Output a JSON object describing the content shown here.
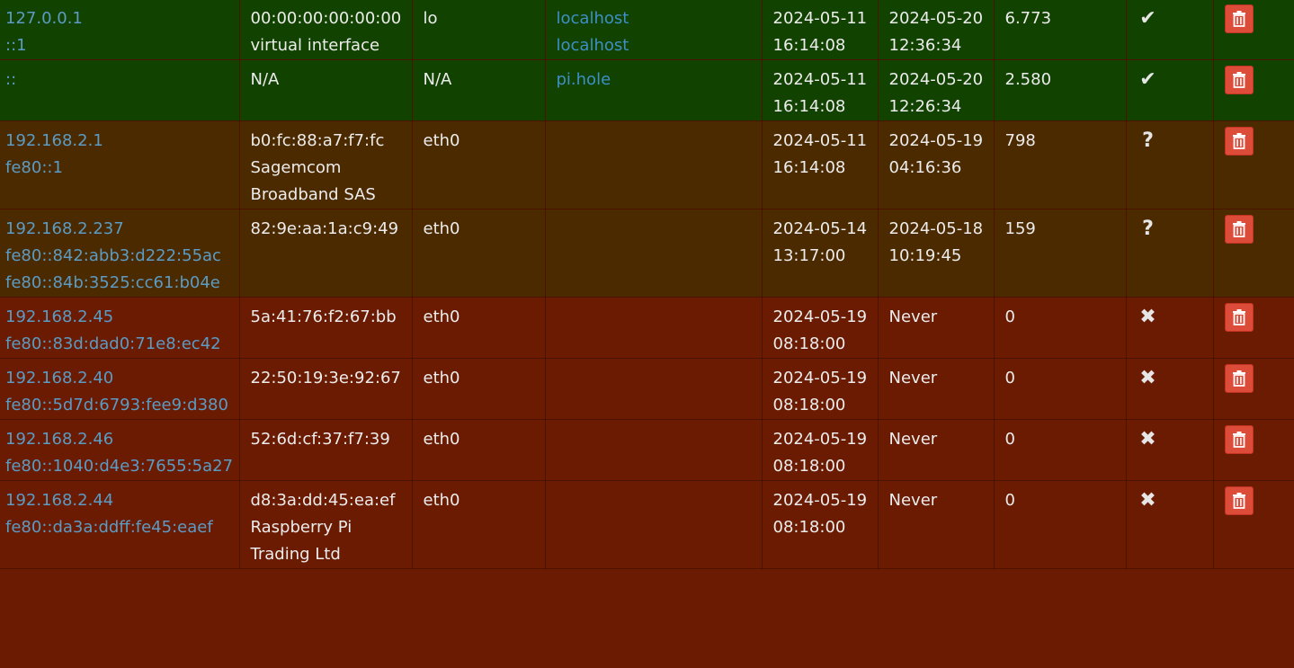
{
  "colors": {
    "active_row": "#124200",
    "unknown_row": "#4c2a00",
    "never_row": "#6a1b02",
    "link": "#3d8fc7",
    "delete_button": "#dd4b39"
  },
  "rows": [
    {
      "status": "active",
      "ips": [
        "127.0.0.1",
        "::1"
      ],
      "hw": [
        "00:00:00:00:00:00",
        "virtual interface"
      ],
      "iface": "lo",
      "names": [
        "localhost",
        "localhost"
      ],
      "first_seen": [
        "2024-05-11",
        "16:14:08"
      ],
      "last_query": [
        "2024-05-20",
        "12:36:34"
      ],
      "queries": "6.773",
      "status_icon": "checkmark-icon"
    },
    {
      "status": "active",
      "ips": [
        "::"
      ],
      "hw": [
        "N/A"
      ],
      "iface": "N/A",
      "names": [
        "pi.hole"
      ],
      "first_seen": [
        "2024-05-11",
        "16:14:08"
      ],
      "last_query": [
        "2024-05-20",
        "12:26:34"
      ],
      "queries": "2.580",
      "status_icon": "checkmark-icon"
    },
    {
      "status": "unknown",
      "ips": [
        "192.168.2.1",
        "fe80::1"
      ],
      "hw": [
        "b0:fc:88:a7:f7:fc",
        "Sagemcom",
        "Broadband SAS"
      ],
      "iface": "eth0",
      "names": [],
      "first_seen": [
        "2024-05-11",
        "16:14:08"
      ],
      "last_query": [
        "2024-05-19",
        "04:16:36"
      ],
      "queries": "798",
      "status_icon": "question-icon"
    },
    {
      "status": "unknown",
      "ips": [
        "192.168.2.237",
        "fe80::842:abb3:d222:55ac",
        "fe80::84b:3525:cc61:b04e"
      ],
      "hw": [
        "82:9e:aa:1a:c9:49"
      ],
      "iface": "eth0",
      "names": [],
      "first_seen": [
        "2024-05-14",
        "13:17:00"
      ],
      "last_query": [
        "2024-05-18",
        "10:19:45"
      ],
      "queries": "159",
      "status_icon": "question-icon"
    },
    {
      "status": "never",
      "ips": [
        "192.168.2.45",
        "fe80::83d:dad0:71e8:ec42"
      ],
      "hw": [
        "5a:41:76:f2:67:bb"
      ],
      "iface": "eth0",
      "names": [],
      "first_seen": [
        "2024-05-19",
        "08:18:00"
      ],
      "last_query": [
        "Never"
      ],
      "queries": "0",
      "status_icon": "cross-icon"
    },
    {
      "status": "never",
      "ips": [
        "192.168.2.40",
        "fe80::5d7d:6793:fee9:d380"
      ],
      "hw": [
        "22:50:19:3e:92:67"
      ],
      "iface": "eth0",
      "names": [],
      "first_seen": [
        "2024-05-19",
        "08:18:00"
      ],
      "last_query": [
        "Never"
      ],
      "queries": "0",
      "status_icon": "cross-icon"
    },
    {
      "status": "never",
      "ips": [
        "192.168.2.46",
        "fe80::1040:d4e3:7655:5a27"
      ],
      "hw": [
        "52:6d:cf:37:f7:39"
      ],
      "iface": "eth0",
      "names": [],
      "first_seen": [
        "2024-05-19",
        "08:18:00"
      ],
      "last_query": [
        "Never"
      ],
      "queries": "0",
      "status_icon": "cross-icon"
    },
    {
      "status": "never",
      "ips": [
        "192.168.2.44",
        "fe80::da3a:ddff:fe45:eaef"
      ],
      "hw": [
        "d8:3a:dd:45:ea:ef",
        "Raspberry Pi",
        "Trading Ltd"
      ],
      "iface": "eth0",
      "names": [],
      "first_seen": [
        "2024-05-19",
        "08:18:00"
      ],
      "last_query": [
        "Never"
      ],
      "queries": "0",
      "status_icon": "cross-icon"
    }
  ]
}
